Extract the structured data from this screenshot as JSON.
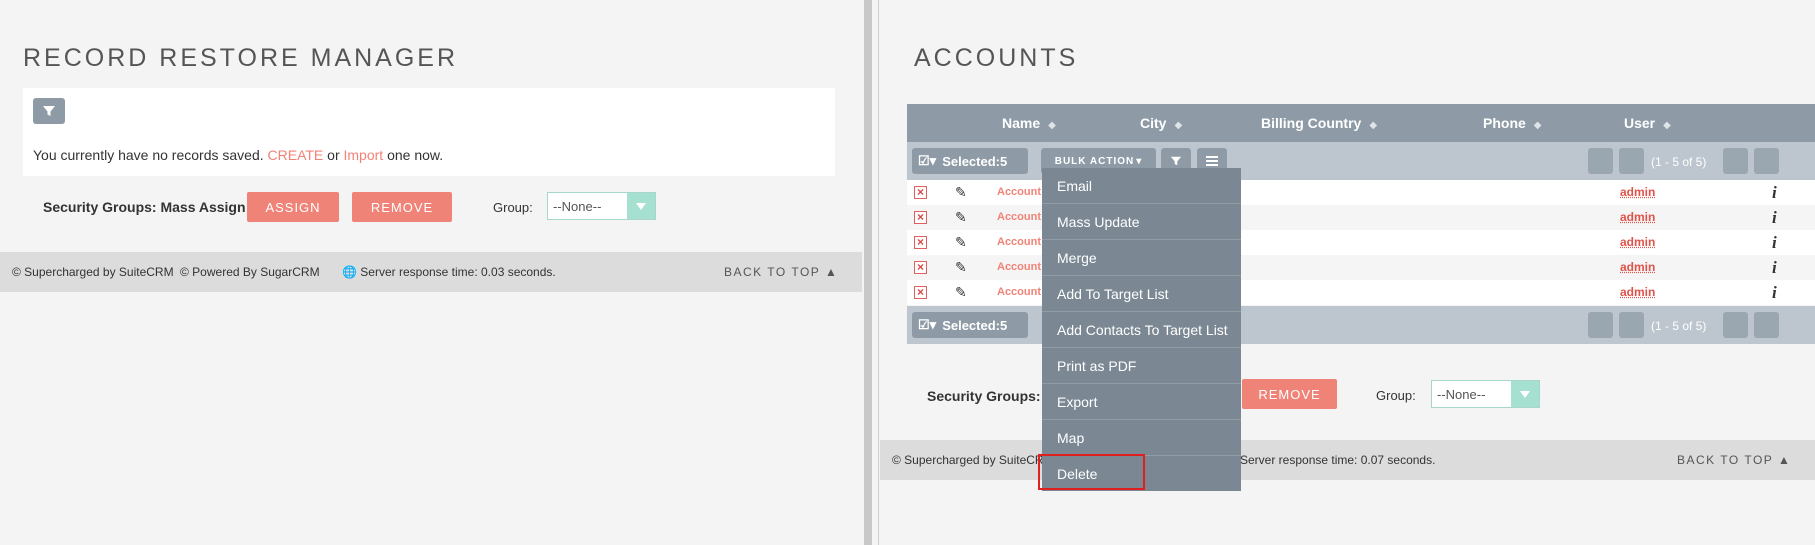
{
  "left": {
    "title": "RECORD RESTORE MANAGER",
    "message_prefix": "You currently have no records saved.",
    "create_link": "CREATE",
    "or_text": "or",
    "import_link": "Import",
    "message_suffix": "one now.",
    "security_label": "Security Groups: Mass Assign",
    "assign_button": "ASSIGN",
    "remove_button": "REMOVE",
    "group_label": "Group:",
    "group_value": "--None--",
    "footer": {
      "suitecrm": "© Supercharged by SuiteCRM",
      "sugarcrm": "© Powered By SugarCRM",
      "response": "Server response time: 0.03 seconds.",
      "back_to_top": "BACK TO TOP"
    }
  },
  "right": {
    "title": "ACCOUNTS",
    "columns": [
      "Name",
      "City",
      "Billing Country",
      "Phone",
      "User"
    ],
    "selected_label": "Selected:5",
    "bulk_action": "BULK ACTION",
    "pagination": "(1 - 5 of 5)",
    "rows": [
      {
        "name": "Account",
        "user": "admin"
      },
      {
        "name": "Account",
        "user": "admin"
      },
      {
        "name": "Account",
        "user": "admin"
      },
      {
        "name": "Account",
        "user": "admin"
      },
      {
        "name": "Account",
        "user": "admin"
      }
    ],
    "security_label": "Security Groups: M",
    "remove_button": "REMOVE",
    "group_label": "Group:",
    "group_value": "--None--",
    "footer": {
      "suitecrm": "© Supercharged by SuiteCR",
      "response": "Server response time: 0.07 seconds.",
      "back_to_top": "BACK TO TOP"
    },
    "bulk_menu": [
      "Email",
      "Mass Update",
      "Merge",
      "Add To Target List",
      "Add Contacts To Target List",
      "Print as PDF",
      "Export",
      "Map",
      "Delete"
    ]
  },
  "colors": {
    "accent": "#f08377",
    "header": "#8e9ba6",
    "menu": "#7b8893",
    "highlight": "#e02020"
  }
}
